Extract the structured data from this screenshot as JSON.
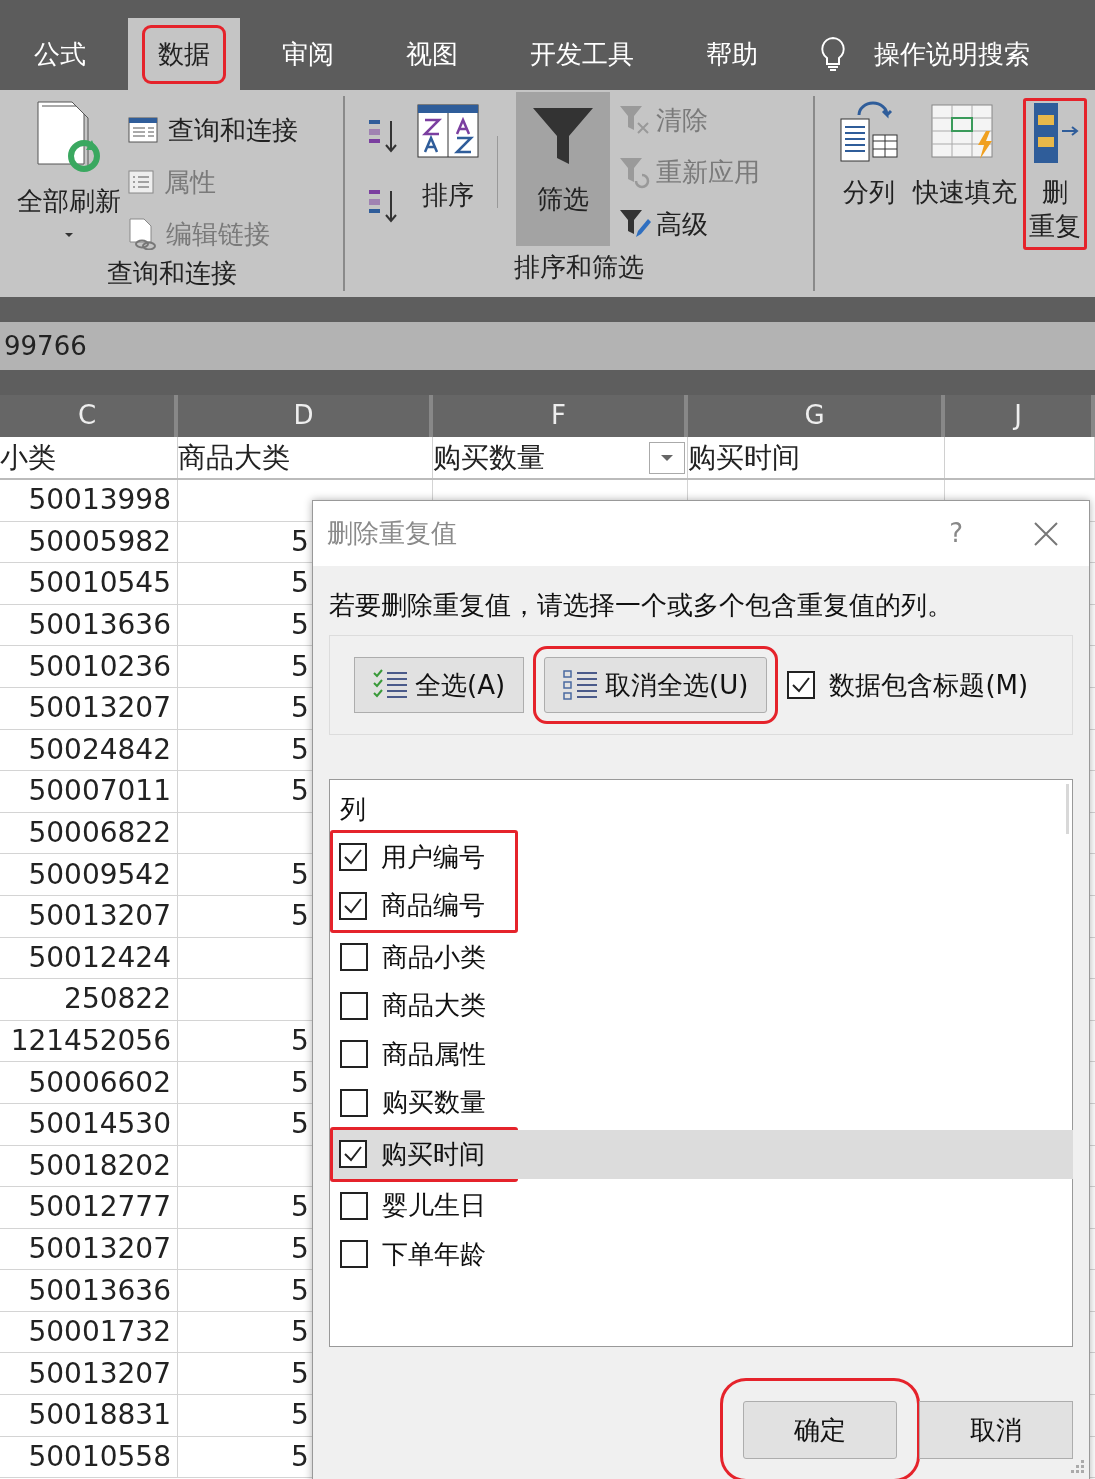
{
  "tabs": [
    {
      "label": "公式",
      "selected": false,
      "highlighted": false
    },
    {
      "label": "数据",
      "selected": true,
      "highlighted": true
    },
    {
      "label": "审阅",
      "selected": false,
      "highlighted": false
    },
    {
      "label": "视图",
      "selected": false,
      "highlighted": false
    },
    {
      "label": "开发工具",
      "selected": false,
      "highlighted": false
    },
    {
      "label": "帮助",
      "selected": false,
      "highlighted": false
    },
    {
      "label": "操作说明搜索",
      "kind": "search",
      "selected": false,
      "highlighted": false
    }
  ],
  "ribbon": {
    "query_group": {
      "label": "查询和连接",
      "refresh": {
        "label": "全部刷新"
      },
      "items": [
        {
          "label": "查询和连接",
          "disabled": false
        },
        {
          "label": "属性",
          "disabled": true
        },
        {
          "label": "编辑链接",
          "disabled": true
        }
      ]
    },
    "sort_group": {
      "label": "排序和筛选",
      "sort": {
        "label": "排序"
      },
      "filter": {
        "label": "筛选",
        "pressed": true
      },
      "items": [
        {
          "label": "清除",
          "disabled": true
        },
        {
          "label": "重新应用",
          "disabled": true
        },
        {
          "label": "高级",
          "disabled": false
        }
      ]
    },
    "tools_group": {
      "buttons": [
        {
          "lines": [
            "分列"
          ],
          "highlighted": false
        },
        {
          "lines": [
            "快速填充"
          ],
          "highlighted": false
        },
        {
          "lines": [
            "删",
            "重复"
          ],
          "highlighted": true
        }
      ]
    }
  },
  "formula_bar": {
    "value": "99766"
  },
  "sheet": {
    "columns": [
      {
        "letter": "C",
        "header": "小类",
        "filter": false
      },
      {
        "letter": "D",
        "header": "商品大类",
        "filter": false
      },
      {
        "letter": "F",
        "header": "购买数量",
        "filter": true
      },
      {
        "letter": "G",
        "header": "购买时间",
        "filter": false
      },
      {
        "letter": "J",
        "filter": false
      }
    ],
    "rows": [
      {
        "c": "50013998"
      },
      {
        "c": "50005982",
        "d": "5",
        "d_cut": true
      },
      {
        "c": "50010545",
        "d": "5",
        "d_cut": true
      },
      {
        "c": "50013636",
        "d": "5",
        "d_cut": true
      },
      {
        "c": "50010236",
        "d": "5",
        "d_cut": true
      },
      {
        "c": "50013207",
        "d": "5",
        "d_cut": true
      },
      {
        "c": "50024842",
        "d": "5",
        "d_cut": true
      },
      {
        "c": "50007011",
        "d": "5",
        "d_cut": true
      },
      {
        "c": "50006822"
      },
      {
        "c": "50009542",
        "d": "5",
        "d_cut": true
      },
      {
        "c": "50013207",
        "d": "5",
        "d_cut": true
      },
      {
        "c": "50012424"
      },
      {
        "c": "250822"
      },
      {
        "c": "121452056",
        "d": "5",
        "d_cut": true
      },
      {
        "c": "50006602",
        "d": "5",
        "d_cut": true
      },
      {
        "c": "50014530",
        "d": "5",
        "d_cut": true
      },
      {
        "c": "50018202"
      },
      {
        "c": "50012777",
        "d": "5",
        "d_cut": true
      },
      {
        "c": "50013207",
        "d": "5",
        "d_cut": true
      },
      {
        "c": "50013636",
        "d": "5",
        "d_cut": true
      },
      {
        "c": "50001732",
        "d": "5",
        "d_cut": true
      },
      {
        "c": "50013207",
        "d": "5",
        "d_cut": true
      },
      {
        "c": "50018831",
        "d": "5",
        "d_cut": true
      },
      {
        "c": "50010558",
        "d": "5",
        "d_cut": true
      }
    ]
  },
  "dialog": {
    "title": "删除重复值",
    "help": "?",
    "instruction": "若要删除重复值，请选择一个或多个包含重复值的列。",
    "select_all": {
      "label": "全选(A)",
      "highlighted": false
    },
    "unselect_all": {
      "label": "取消全选(U)",
      "highlighted": true
    },
    "has_headers": {
      "label": "数据包含标题(M)",
      "checked": true
    },
    "columns": {
      "header": "列",
      "items": [
        {
          "label": "用户编号",
          "checked": true,
          "selected": false,
          "highlighted": true
        },
        {
          "label": "商品编号",
          "checked": true,
          "selected": false,
          "highlighted": true
        },
        {
          "label": "商品小类",
          "checked": false,
          "selected": false,
          "highlighted": false
        },
        {
          "label": "商品大类",
          "checked": false,
          "selected": false,
          "highlighted": false
        },
        {
          "label": "商品属性",
          "checked": false,
          "selected": false,
          "highlighted": false
        },
        {
          "label": "购买数量",
          "checked": false,
          "selected": false,
          "highlighted": false
        },
        {
          "label": "购买时间",
          "checked": true,
          "selected": true,
          "highlighted": true
        },
        {
          "label": "婴儿生日",
          "checked": false,
          "selected": false,
          "highlighted": false
        },
        {
          "label": "下单年龄",
          "checked": false,
          "selected": false,
          "highlighted": false
        }
      ]
    },
    "buttons": [
      {
        "label": "确定",
        "highlighted": true
      },
      {
        "label": "取消",
        "highlighted": false
      }
    ]
  }
}
